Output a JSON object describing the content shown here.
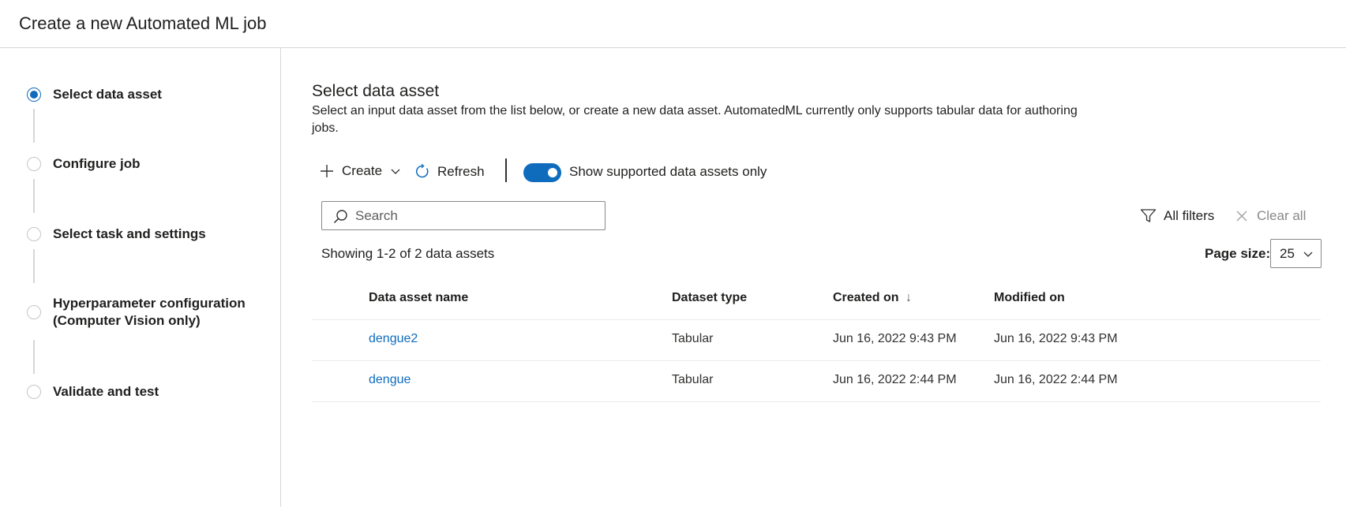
{
  "header": {
    "title": "Create a new Automated ML job"
  },
  "stepper": {
    "steps": [
      {
        "label": "Select data asset",
        "state": "active"
      },
      {
        "label": "Configure job",
        "state": "pending"
      },
      {
        "label": "Select task and settings",
        "state": "pending"
      },
      {
        "label_line1": "Hyperparameter configuration",
        "label_line2": "(Computer Vision only)",
        "state": "pending"
      },
      {
        "label": "Validate and test",
        "state": "pending"
      }
    ]
  },
  "main": {
    "title": "Select data asset",
    "description": "Select an input data asset from the list below, or create a new data asset. AutomatedML currently only supports tabular data for authoring jobs."
  },
  "toolbar": {
    "create_label": "Create",
    "refresh_label": "Refresh",
    "toggle_label": "Show supported data assets only",
    "toggle_on": true
  },
  "search": {
    "placeholder": "Search",
    "value": ""
  },
  "filters": {
    "all_filters_label": "All filters",
    "clear_all_label": "Clear all"
  },
  "summary": {
    "showing_text": "Showing 1-2 of 2 data assets"
  },
  "page_size": {
    "label": "Page size:",
    "value": "25"
  },
  "table": {
    "columns": [
      "Data asset name",
      "Dataset type",
      "Created on",
      "Modified on"
    ],
    "sort_indicator": "↓",
    "rows": [
      {
        "name": "dengue2",
        "type": "Tabular",
        "created": "Jun 16, 2022 9:43 PM",
        "modified": "Jun 16, 2022 9:43 PM"
      },
      {
        "name": "dengue",
        "type": "Tabular",
        "created": "Jun 16, 2022 2:44 PM",
        "modified": "Jun 16, 2022 2:44 PM"
      }
    ]
  },
  "colors": {
    "accent": "#0f6cbd",
    "border": "#d6d6d6",
    "text": "#201f1e"
  },
  "icons": [
    "plus-icon",
    "chevron-down-icon",
    "refresh-icon",
    "search-icon",
    "filter-icon",
    "close-icon"
  ]
}
